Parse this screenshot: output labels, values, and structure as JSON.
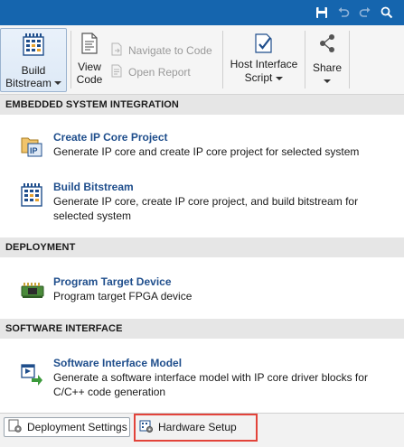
{
  "titlebar": {
    "icons": [
      "save-icon",
      "undo-icon",
      "redo-icon",
      "help-icon"
    ],
    "color": "#1565ae"
  },
  "toolstrip": {
    "build": {
      "line1": "Build",
      "line2": "Bitstream"
    },
    "view_code": {
      "line1": "View",
      "line2": "Code"
    },
    "navigate_to_code": "Navigate to Code",
    "open_report": "Open Report",
    "host_interface": {
      "line1": "Host Interface",
      "line2": "Script"
    },
    "share": "Share"
  },
  "gallery": {
    "sections": [
      {
        "header": "EMBEDDED SYSTEM INTEGRATION",
        "items": [
          {
            "title": "Create IP Core Project",
            "description": "Generate IP core and create IP core project for selected system",
            "icon": "ip-core-folder-icon"
          },
          {
            "title": "Build Bitstream",
            "description": "Generate IP core, create IP core project, and build bitstream for selected system",
            "icon": "bitstream-chip-icon"
          }
        ]
      },
      {
        "header": "DEPLOYMENT",
        "items": [
          {
            "title": "Program Target Device",
            "description": "Program target FPGA device",
            "icon": "fpga-board-icon"
          }
        ]
      },
      {
        "header": "SOFTWARE INTERFACE",
        "items": [
          {
            "title": "Software Interface Model",
            "description": "Generate a software interface model with IP core driver blocks for C/C++ code generation",
            "icon": "software-model-icon"
          }
        ]
      }
    ]
  },
  "bottombar": {
    "deployment_settings": "Deployment Settings",
    "hardware_setup": "Hardware Setup",
    "highlight_color": "#e2433a"
  }
}
